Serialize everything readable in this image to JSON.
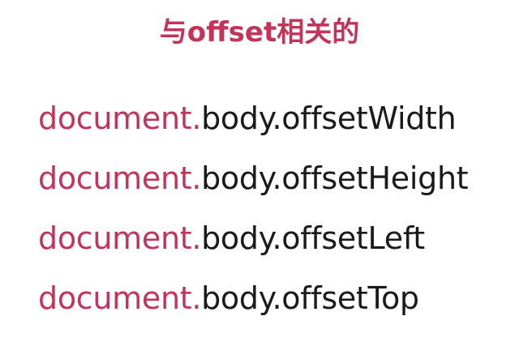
{
  "title": "与offset相关的",
  "lines": [
    {
      "object": "document.",
      "property": "body.offsetWidth"
    },
    {
      "object": "document.",
      "property": "body.offsetHeight"
    },
    {
      "object": "document.",
      "property": "body.offsetLeft"
    },
    {
      "object": "document.",
      "property": "body.offsetTop"
    }
  ],
  "colors": {
    "accent": "#c2345a",
    "text": "#1a1a1a",
    "background": "#ffffff"
  }
}
